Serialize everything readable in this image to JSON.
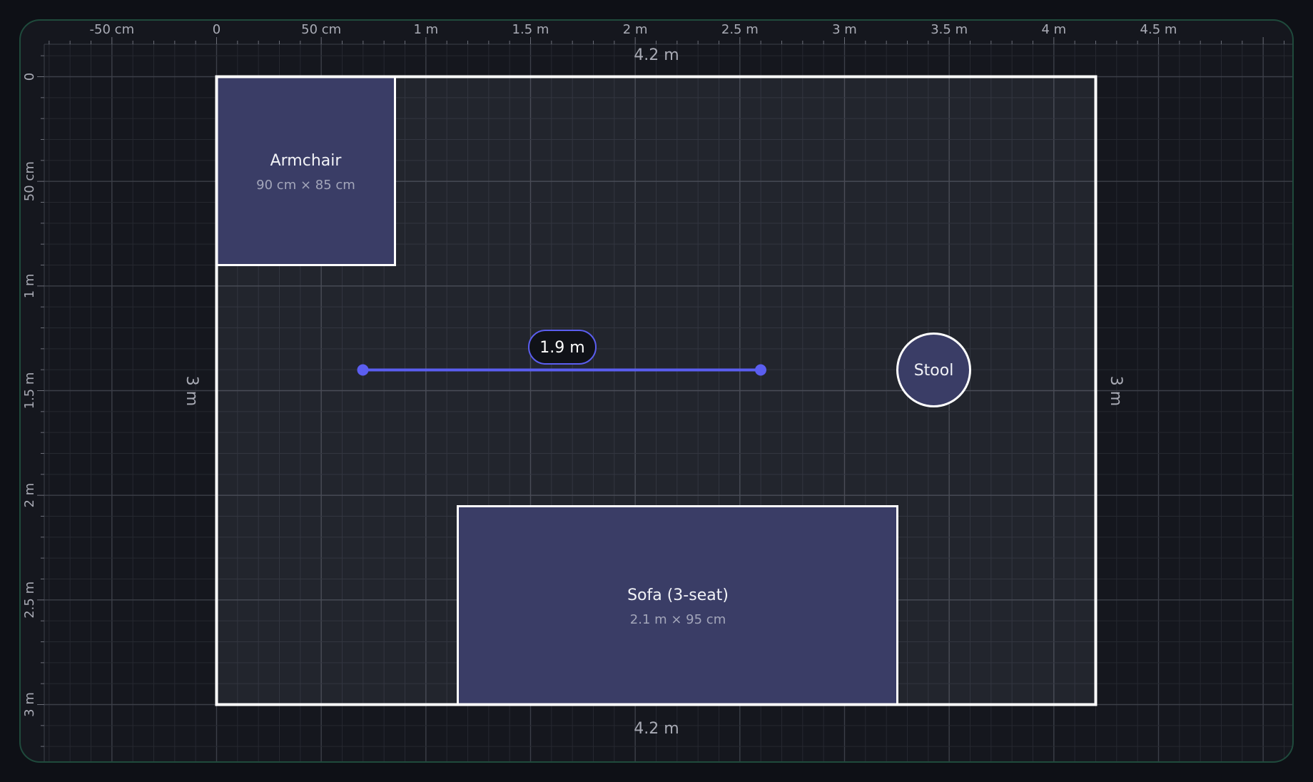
{
  "ruler": {
    "top": [
      "-50 cm",
      "0",
      "50 cm",
      "1 m",
      "1.5 m",
      "2 m",
      "2.5 m",
      "3 m",
      "3.5 m",
      "4 m",
      "4.5 m"
    ],
    "left": [
      "0",
      "50 cm",
      "1 m",
      "1.5 m",
      "2 m",
      "2.5 m",
      "3 m"
    ]
  },
  "room": {
    "width_m": 4.2,
    "depth_m": 3.0,
    "width_label_top": "4.2 m",
    "width_label_bottom": "4.2 m",
    "depth_label_left": "3 m",
    "depth_label_right": "3 m"
  },
  "furniture": {
    "armchair": {
      "name": "Armchair",
      "size": "90 cm × 85 cm"
    },
    "sofa": {
      "name": "Sofa (3-seat)",
      "size": "2.1 m × 95 cm"
    },
    "stool": {
      "name": "Stool"
    }
  },
  "measurement": {
    "label": "1.9 m",
    "value_m": 1.9
  },
  "colors": {
    "background": "#0e1016",
    "canvas": "#15171e",
    "room_fill": "#22252d",
    "furniture_fill": "#3a3d66",
    "wall": "#ffffff",
    "measure": "#5b5ef0",
    "frame": "#1f4a3c"
  }
}
